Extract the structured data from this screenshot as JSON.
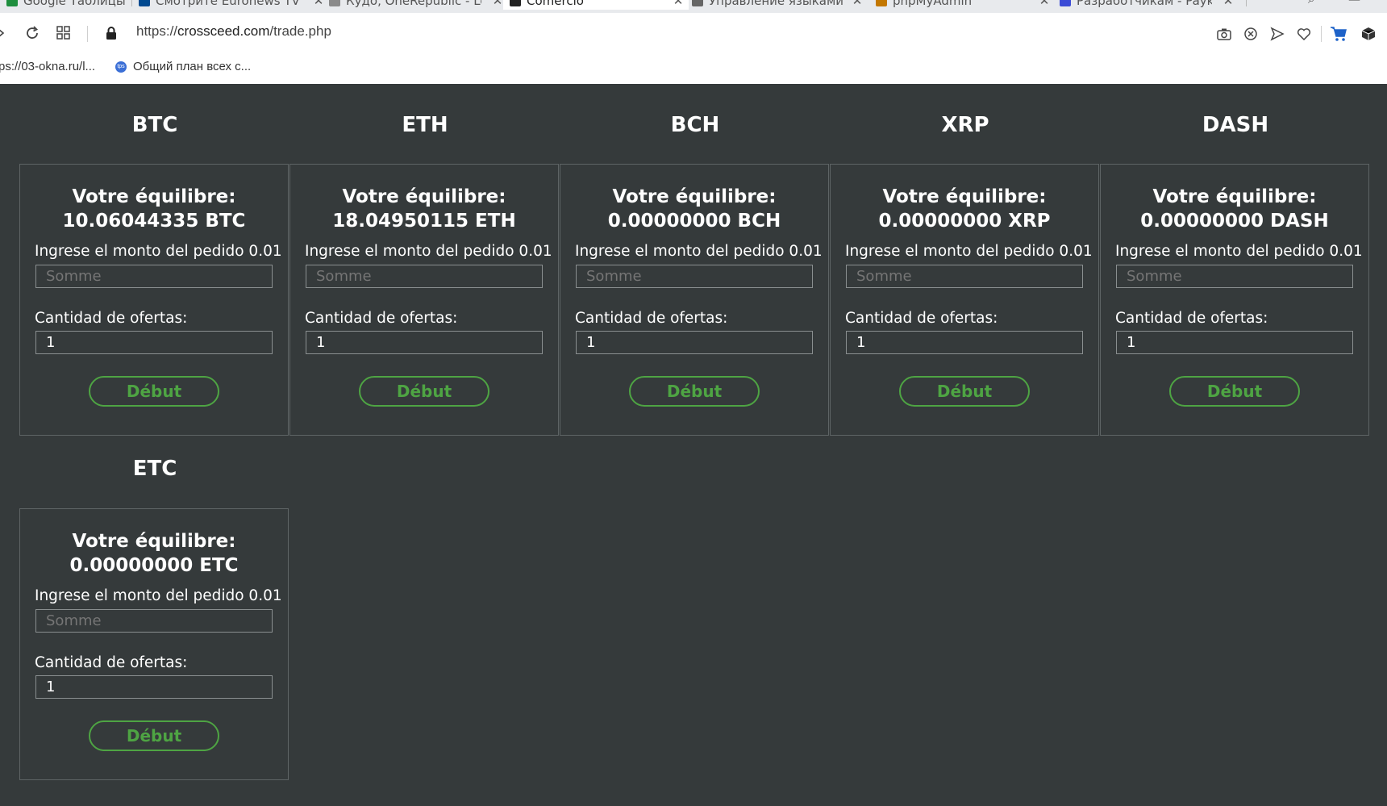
{
  "browser": {
    "tabs": [
      {
        "label": "Google Таблицы",
        "color": "#1e8e3e"
      },
      {
        "label": "Смотрите Euronews TV",
        "color": "#004990"
      },
      {
        "label": "Кудо, OneRepublic - Lo",
        "color": "#6b6b6b"
      },
      {
        "label": "Comercio",
        "color": "#222222",
        "active": true
      },
      {
        "label": "Управление языками",
        "color": "#555555"
      },
      {
        "label": "phpMyAdmin",
        "color": "#c37700"
      },
      {
        "label": "Разработчикам - Payk",
        "color": "#3b4bd6"
      }
    ],
    "url_scheme": "https://",
    "url_host": "crossceed.com",
    "url_path": "/trade.php",
    "bookmarks": [
      {
        "label": "ps://03-okna.ru/l..."
      },
      {
        "label": "Общий план всех с...",
        "icon_text": "tps"
      }
    ],
    "icons": {
      "reload": "reload-icon",
      "tabs_grid": "grid-icon",
      "lock": "lock-icon",
      "camera": "camera-icon",
      "shield": "shield-x-icon",
      "send": "send-icon",
      "heart": "heart-icon",
      "cart": "cart-icon",
      "box": "box-icon"
    }
  },
  "coins": [
    {
      "symbol": "BTC",
      "balance_label": "Votre équilibre:",
      "balance": "10.06044335 BTC",
      "order_label": "Ingrese el monto del pedido 0.01",
      "amount_placeholder": "Somme",
      "qty_label": "Cantidad de ofertas:",
      "qty_value": "1",
      "button": "Début"
    },
    {
      "symbol": "ETH",
      "balance_label": "Votre équilibre:",
      "balance": "18.04950115 ETH",
      "order_label": "Ingrese el monto del pedido 0.01",
      "amount_placeholder": "Somme",
      "qty_label": "Cantidad de ofertas:",
      "qty_value": "1",
      "button": "Début"
    },
    {
      "symbol": "BCH",
      "balance_label": "Votre équilibre:",
      "balance": "0.00000000 BCH",
      "order_label": "Ingrese el monto del pedido 0.01",
      "amount_placeholder": "Somme",
      "qty_label": "Cantidad de ofertas:",
      "qty_value": "1",
      "button": "Début"
    },
    {
      "symbol": "XRP",
      "balance_label": "Votre équilibre:",
      "balance": "0.00000000 XRP",
      "order_label": "Ingrese el monto del pedido 0.01",
      "amount_placeholder": "Somme",
      "qty_label": "Cantidad de ofertas:",
      "qty_value": "1",
      "button": "Début"
    },
    {
      "symbol": "DASH",
      "balance_label": "Votre équilibre:",
      "balance": "0.00000000 DASH",
      "order_label": "Ingrese el monto del pedido 0.01",
      "amount_placeholder": "Somme",
      "qty_label": "Cantidad de ofertas:",
      "qty_value": "1",
      "button": "Début"
    },
    {
      "symbol": "ETC",
      "balance_label": "Votre équilibre:",
      "balance": "0.00000000 ETC",
      "order_label": "Ingrese el monto del pedido 0.01",
      "amount_placeholder": "Somme",
      "qty_label": "Cantidad de ofertas:",
      "qty_value": "1",
      "button": "Début"
    }
  ],
  "colors": {
    "page_bg": "#353a3b",
    "card_border": "#5e6465",
    "accent_green": "#4ea443",
    "text": "#ffffff"
  }
}
